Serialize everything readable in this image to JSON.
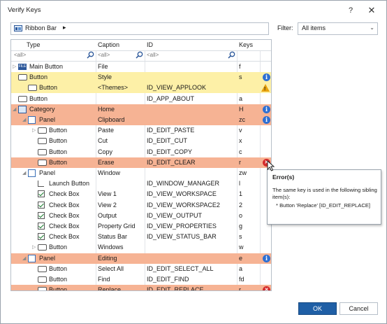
{
  "window": {
    "title": "Verify Keys",
    "help_glyph": "?",
    "close_glyph": "✕"
  },
  "path": {
    "label": "Ribbon Bar",
    "arrow": "▸"
  },
  "filter": {
    "label": "Filter:",
    "value": "All items"
  },
  "columns": [
    "Type",
    "Caption",
    "ID",
    "Keys"
  ],
  "filter_row": {
    "type": "<all>",
    "caption": "<all>",
    "id": "<all>"
  },
  "rows": [
    {
      "type": "Main Button",
      "caption": "File",
      "id": "",
      "keys": "f",
      "hl": "",
      "badge": "",
      "icon": "file"
    },
    {
      "type": "Button",
      "caption": "Style",
      "id": "",
      "keys": "s",
      "hl": "yellow",
      "badge": "info",
      "icon": "node"
    },
    {
      "type": "Button",
      "caption": "<Themes>",
      "id": "ID_VIEW_APPLOOK",
      "keys": "",
      "hl": "yellow",
      "badge": "warn",
      "icon": "node"
    },
    {
      "type": "Button",
      "caption": "",
      "id": "ID_APP_ABOUT",
      "keys": "a",
      "hl": "",
      "badge": "",
      "icon": "node"
    },
    {
      "type": "Category",
      "caption": "Home",
      "id": "",
      "keys": "H",
      "hl": "orange",
      "badge": "info",
      "icon": "cat"
    },
    {
      "type": "Panel",
      "caption": "Clipboard",
      "id": "",
      "keys": "zc",
      "hl": "orange",
      "badge": "info",
      "icon": "nodeblue"
    },
    {
      "type": "Button",
      "caption": "Paste",
      "id": "ID_EDIT_PASTE",
      "keys": "v",
      "hl": "",
      "badge": "",
      "icon": "node"
    },
    {
      "type": "Button",
      "caption": "Cut",
      "id": "ID_EDIT_CUT",
      "keys": "x",
      "hl": "",
      "badge": "",
      "icon": "node"
    },
    {
      "type": "Button",
      "caption": "Copy",
      "id": "ID_EDIT_COPY",
      "keys": "c",
      "hl": "",
      "badge": "",
      "icon": "node"
    },
    {
      "type": "Button",
      "caption": "Erase",
      "id": "ID_EDIT_CLEAR",
      "keys": "r",
      "hl": "orange",
      "badge": "err",
      "icon": "node"
    },
    {
      "type": "Panel",
      "caption": "Window",
      "id": "",
      "keys": "zw",
      "hl": "",
      "badge": "",
      "icon": "nodeblue"
    },
    {
      "type": "Launch Button",
      "caption": "",
      "id": "ID_WINDOW_MANAGER",
      "keys": "l",
      "hl": "",
      "badge": "",
      "icon": "launch"
    },
    {
      "type": "Check Box",
      "caption": "View 1",
      "id": "ID_VIEW_WORKSPACE",
      "keys": "1",
      "hl": "",
      "badge": "",
      "icon": "chk"
    },
    {
      "type": "Check Box",
      "caption": "View 2",
      "id": "ID_VIEW_WORKSPACE2",
      "keys": "2",
      "hl": "",
      "badge": "",
      "icon": "chk"
    },
    {
      "type": "Check Box",
      "caption": "Output",
      "id": "ID_VIEW_OUTPUT",
      "keys": "o",
      "hl": "",
      "badge": "",
      "icon": "chk"
    },
    {
      "type": "Check Box",
      "caption": "Property Grid",
      "id": "ID_VIEW_PROPERTIES",
      "keys": "g",
      "hl": "",
      "badge": "",
      "icon": "chk"
    },
    {
      "type": "Check Box",
      "caption": "Status Bar",
      "id": "ID_VIEW_STATUS_BAR",
      "keys": "s",
      "hl": "",
      "badge": "",
      "icon": "chk"
    },
    {
      "type": "Button",
      "caption": "Windows",
      "id": "",
      "keys": "w",
      "hl": "",
      "badge": "",
      "icon": "node"
    },
    {
      "type": "Panel",
      "caption": "Editing",
      "id": "",
      "keys": "e",
      "hl": "orange",
      "badge": "info",
      "icon": "nodeblue"
    },
    {
      "type": "Button",
      "caption": "Select All",
      "id": "ID_EDIT_SELECT_ALL",
      "keys": "a",
      "hl": "",
      "badge": "",
      "icon": "node"
    },
    {
      "type": "Button",
      "caption": "Find",
      "id": "ID_EDIT_FIND",
      "keys": "fd",
      "hl": "",
      "badge": "",
      "icon": "node"
    },
    {
      "type": "Button",
      "caption": "Replace",
      "id": "ID_EDIT_REPLACE",
      "keys": "r",
      "hl": "orange",
      "badge": "err",
      "icon": "node"
    }
  ],
  "tooltip": {
    "title": "Error(s)",
    "body": "The same key is used in the following sibling item(s):",
    "item": "* Button 'Replace' [ID_EDIT_REPLACE]"
  },
  "buttons": {
    "ok": "OK",
    "cancel": "Cancel"
  },
  "colors": {
    "yellow_row": "#fdf0a7",
    "orange_row": "#f6b394",
    "accent": "#1f5fa6"
  }
}
